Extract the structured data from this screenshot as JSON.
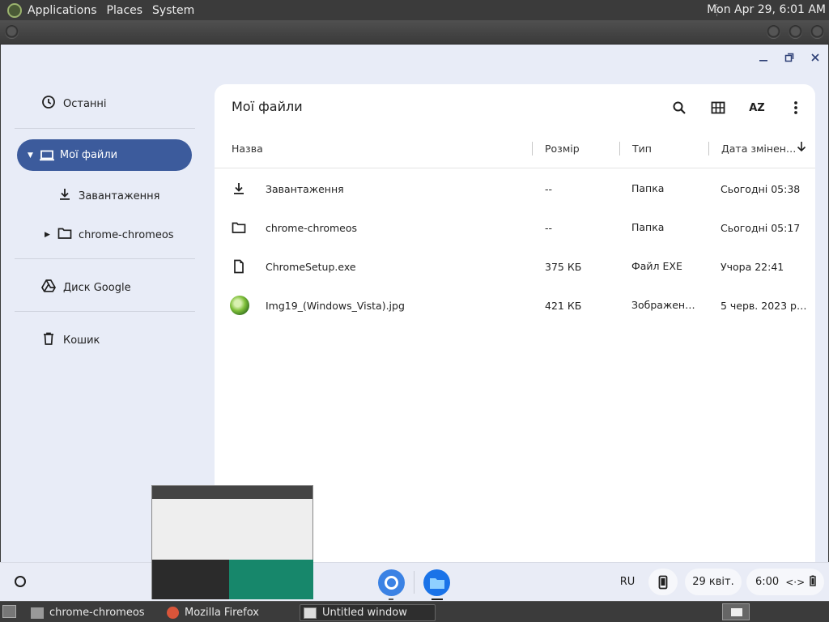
{
  "topbar": {
    "menu": [
      "Applications",
      "Places",
      "System"
    ],
    "clock": "Mon Apr 29,  6:01 AM"
  },
  "window": {
    "title": "Мої файли",
    "controls": [
      "minimize-icon",
      "restore-icon",
      "close-icon"
    ]
  },
  "sidebar": {
    "recent": "Останні",
    "my_files": "Мої файли",
    "downloads": "Завантаження",
    "chrome_folder": "chrome-chromeos",
    "google_drive": "Диск Google",
    "trash": "Кошик"
  },
  "toolbar": {
    "icons": [
      "search-icon",
      "grid-view-icon",
      "sort-az-icon",
      "more-vert-icon"
    ],
    "sort_label": "AZ"
  },
  "table": {
    "columns": [
      "Назва",
      "Розмір",
      "Тип",
      "Дата змінен…"
    ],
    "rows": [
      {
        "name": "Завантаження",
        "size": "--",
        "type": "Папка",
        "date": "Сьогодні 05:38",
        "icon": "download-icon"
      },
      {
        "name": "chrome-chromeos",
        "size": "--",
        "type": "Папка",
        "date": "Сьогодні 05:17",
        "icon": "folder-icon"
      },
      {
        "name": "ChromeSetup.exe",
        "size": "375 КБ",
        "type": "Файл EXE",
        "date": "Учора 22:41",
        "icon": "file-icon"
      },
      {
        "name": "Img19_(Windows_Vista).jpg",
        "size": "421 КБ",
        "type": "Зображен…",
        "date": "5 черв. 2023 р…",
        "icon": "image-thumbnail"
      }
    ]
  },
  "shelf": {
    "lang": "RU",
    "date": "29 квіт.",
    "time": "6:00"
  },
  "taskbar": {
    "tasks": [
      "chrome-chromeos",
      "Mozilla Firefox",
      "Untitled window"
    ]
  },
  "colors": {
    "accent": "#3c5b9c",
    "window_bg": "#e8ecf7",
    "panel": "#3b3b3b"
  }
}
